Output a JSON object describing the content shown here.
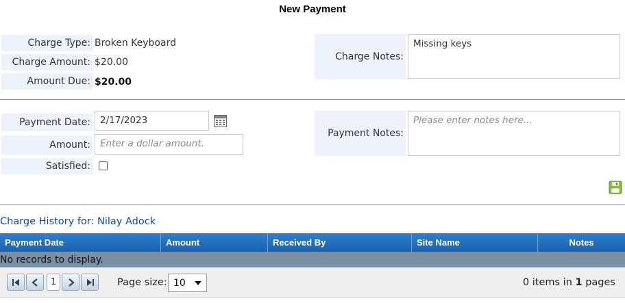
{
  "page": {
    "title": "New Payment"
  },
  "charge": {
    "type_label": "Charge Type:",
    "type_value": "Broken Keyboard",
    "amount_label": "Charge Amount:",
    "amount_value": "$20.00",
    "due_label": "Amount Due:",
    "due_value": "$20.00",
    "notes_label": "Charge Notes:",
    "notes_value": "Missing keys"
  },
  "payment": {
    "date_label": "Payment Date:",
    "date_value": "2/17/2023",
    "amount_label": "Amount:",
    "amount_placeholder": "Enter a dollar amount.",
    "satisfied_label": "Satisfied:",
    "satisfied_checked": false,
    "notes_label": "Payment Notes:",
    "notes_placeholder": "Please enter notes here..."
  },
  "icons": {
    "calendar": "calendar-icon",
    "save": "save-icon",
    "save_color": "#8bbf3f"
  },
  "history": {
    "title": "Charge History for: Nilay Adock",
    "columns": [
      "Payment Date",
      "Amount",
      "Received By",
      "Site Name",
      "Notes"
    ],
    "empty_text": "No records to display."
  },
  "pager": {
    "current_page": "1",
    "page_size_label": "Page size:",
    "page_size_value": "10",
    "items_prefix": "0 items in ",
    "pages_count": "1",
    "items_suffix": " pages"
  },
  "colors": {
    "header_blue": "#1f6bb8",
    "label_bg": "#eef2fb",
    "link_blue": "#0d4a9a"
  }
}
